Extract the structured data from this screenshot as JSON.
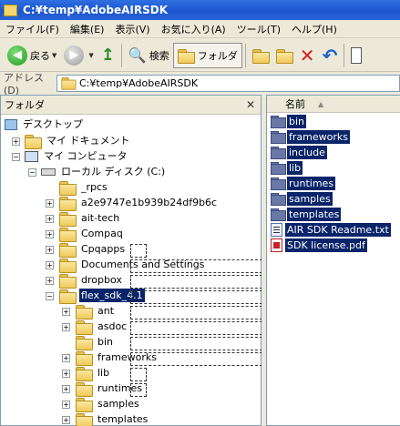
{
  "window": {
    "title": "C:¥temp¥AdobeAIRSDK"
  },
  "menu": [
    "ファイル(F)",
    "編集(E)",
    "表示(V)",
    "お気に入り(A)",
    "ツール(T)",
    "ヘルプ(H)"
  ],
  "toolbar": {
    "back_label": "戻る",
    "search_label": "検索",
    "folders_label": "フォルダ"
  },
  "address": {
    "label": "アドレス(D)",
    "value": "C:¥temp¥AdobeAIRSDK"
  },
  "left_pane": {
    "title": "フォルダ",
    "tree": [
      {
        "label": "デスクトップ"
      },
      {
        "label": "マイ ドキュメント"
      },
      {
        "label": "マイ コンピュータ"
      },
      {
        "label": "ローカル ディスク (C:)"
      },
      {
        "label": "_rpcs"
      },
      {
        "label": "a2e9747e1b939b24df9b6c"
      },
      {
        "label": "ait-tech"
      },
      {
        "label": "Compaq"
      },
      {
        "label": "Cpqapps"
      },
      {
        "label": "Documents and Settings"
      },
      {
        "label": "dropbox"
      },
      {
        "label": "flex_sdk_4.1"
      },
      {
        "label": "ant"
      },
      {
        "label": "asdoc"
      },
      {
        "label": "bin"
      },
      {
        "label": "frameworks"
      },
      {
        "label": "lib"
      },
      {
        "label": "runtimes"
      },
      {
        "label": "samples"
      },
      {
        "label": "templates"
      }
    ]
  },
  "right_pane": {
    "column_name": "名前",
    "items": [
      {
        "label": "bin",
        "kind": "folder"
      },
      {
        "label": "frameworks",
        "kind": "folder"
      },
      {
        "label": "include",
        "kind": "folder"
      },
      {
        "label": "lib",
        "kind": "folder"
      },
      {
        "label": "runtimes",
        "kind": "folder"
      },
      {
        "label": "samples",
        "kind": "folder"
      },
      {
        "label": "templates",
        "kind": "folder"
      },
      {
        "label": "AIR SDK Readme.txt",
        "kind": "txt"
      },
      {
        "label": "SDK license.pdf",
        "kind": "pdf"
      }
    ]
  }
}
